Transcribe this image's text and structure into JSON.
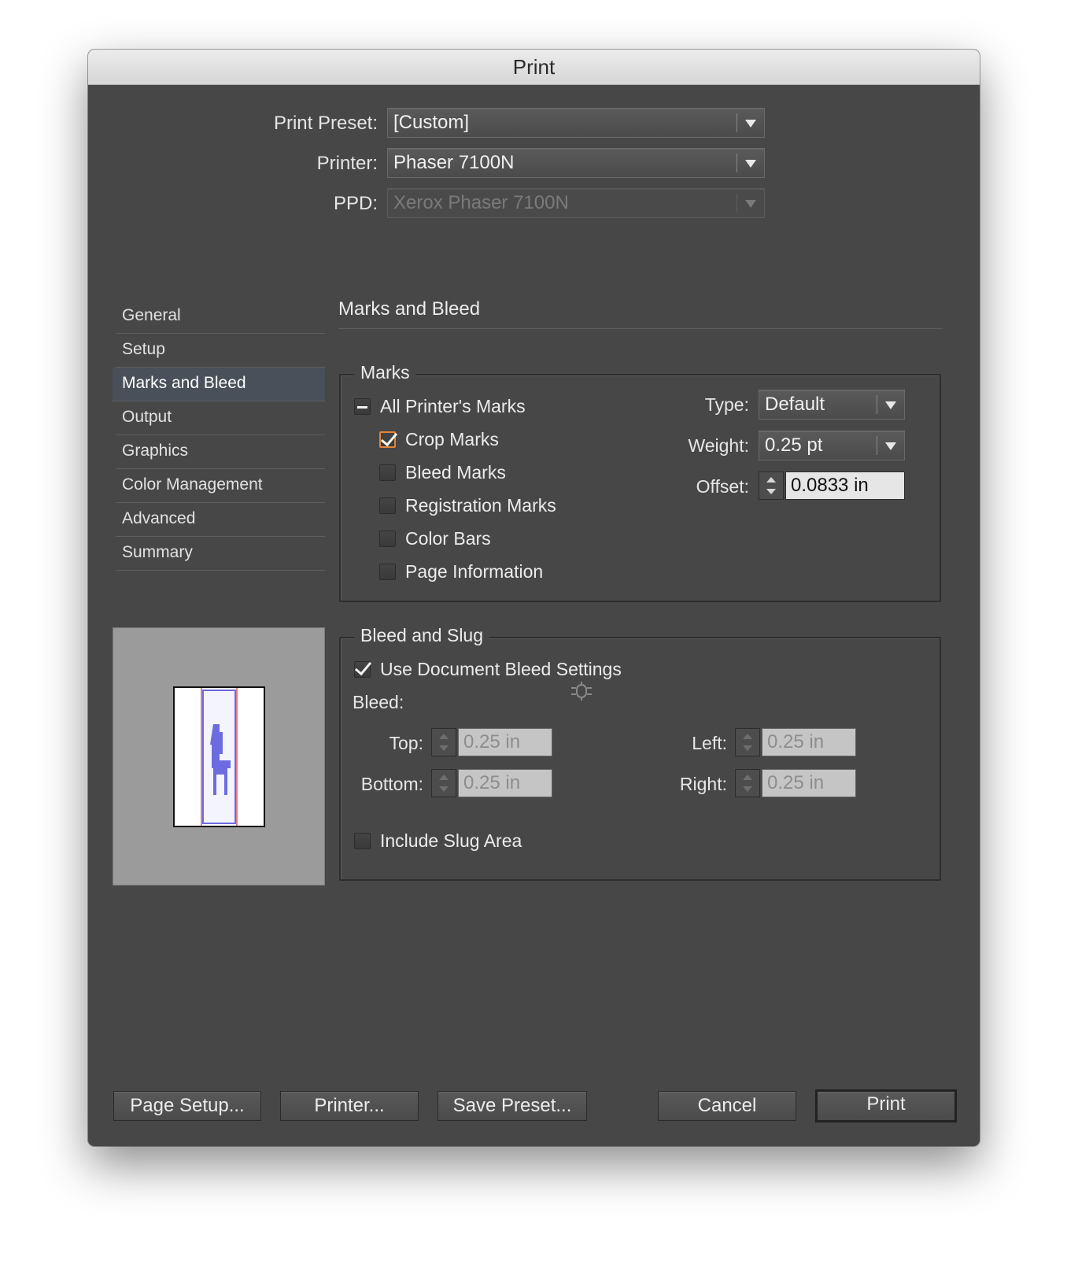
{
  "window": {
    "title": "Print"
  },
  "top": {
    "preset_label": "Print Preset:",
    "preset_value": "[Custom]",
    "printer_label": "Printer:",
    "printer_value": "Phaser 7100N",
    "ppd_label": "PPD:",
    "ppd_value": "Xerox Phaser 7100N"
  },
  "sidebar": {
    "items": [
      {
        "label": "General"
      },
      {
        "label": "Setup"
      },
      {
        "label": "Marks and Bleed",
        "selected": true
      },
      {
        "label": "Output"
      },
      {
        "label": "Graphics"
      },
      {
        "label": "Color Management"
      },
      {
        "label": "Advanced"
      },
      {
        "label": "Summary"
      }
    ]
  },
  "panel": {
    "title": "Marks and Bleed"
  },
  "marks": {
    "legend": "Marks",
    "all_printers_marks": {
      "label": "All Printer's Marks",
      "state": "mixed"
    },
    "crop_marks": {
      "label": "Crop Marks",
      "checked": true
    },
    "bleed_marks": {
      "label": "Bleed Marks",
      "checked": false
    },
    "registration_marks": {
      "label": "Registration Marks",
      "checked": false
    },
    "color_bars": {
      "label": "Color Bars",
      "checked": false
    },
    "page_information": {
      "label": "Page Information",
      "checked": false
    },
    "type_label": "Type:",
    "type_value": "Default",
    "weight_label": "Weight:",
    "weight_value": "0.25 pt",
    "offset_label": "Offset:",
    "offset_value": "0.0833 in"
  },
  "bleed_slug": {
    "legend": "Bleed and Slug",
    "use_document": {
      "label": "Use Document Bleed Settings",
      "checked": true
    },
    "bleed_label": "Bleed:",
    "top_label": "Top:",
    "top_value": "0.25 in",
    "bottom_label": "Bottom:",
    "bottom_value": "0.25 in",
    "left_label": "Left:",
    "left_value": "0.25 in",
    "right_label": "Right:",
    "right_value": "0.25 in",
    "include_slug": {
      "label": "Include Slug Area",
      "checked": false
    }
  },
  "buttons": {
    "page_setup": "Page Setup...",
    "printer": "Printer...",
    "save_preset": "Save Preset...",
    "cancel": "Cancel",
    "print": "Print"
  },
  "colors": {
    "dialog_bg": "#474747",
    "selected_item": "#49505a",
    "focus_ring": "#e0863a",
    "bleed_line": "#e47b8e",
    "page_outline": "#6c6ce0"
  }
}
